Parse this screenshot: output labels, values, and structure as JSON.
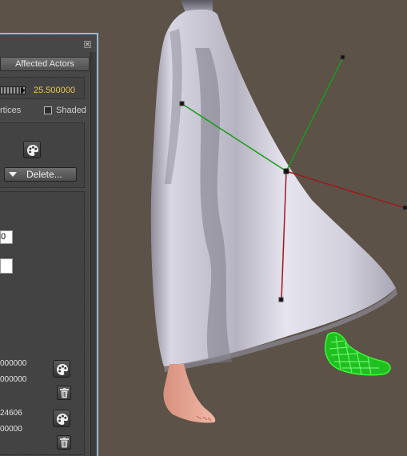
{
  "panel": {
    "close_glyph": "✕",
    "affected_actors_label": "Affected Actors",
    "slider_value": "25.500000",
    "vertices_label": "rtices",
    "shaded_label": "Shaded",
    "shaded_checked": false,
    "delete_label": "Delete...",
    "field_1_value": "0",
    "field_2_value": "",
    "values": [
      "000000",
      "000000",
      "24606",
      "00000"
    ]
  },
  "colors": {
    "background": "#5c5247",
    "panel": "#474747",
    "panel_border": "#9db8d4",
    "slider_value": "#e8c84a",
    "green_axis": "#1a9c1a",
    "red_axis": "#9c1a1a",
    "foot_highlight": "#33ff33"
  },
  "icons": {
    "close": "close-icon",
    "palette": "palette-icon",
    "trash": "trash-icon",
    "dropdown": "triangle-down-icon"
  }
}
